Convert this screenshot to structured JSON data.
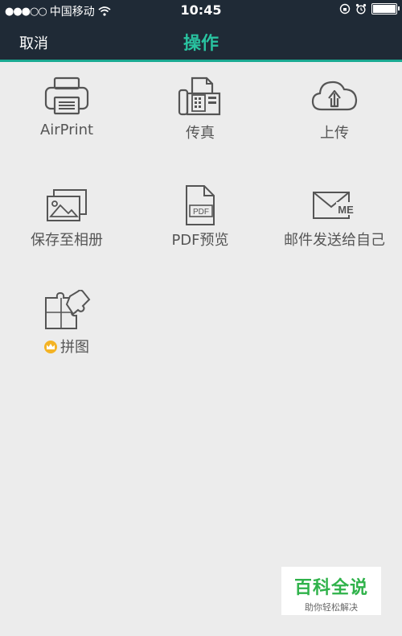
{
  "status": {
    "carrier": "中国移动",
    "time": "10:45"
  },
  "nav": {
    "cancel": "取消",
    "title": "操作"
  },
  "actions": [
    {
      "label": "AirPrint",
      "icon": "printer-icon"
    },
    {
      "label": "传真",
      "icon": "fax-icon"
    },
    {
      "label": "上传",
      "icon": "cloud-upload-icon"
    },
    {
      "label": "保存至相册",
      "icon": "photo-album-icon"
    },
    {
      "label": "PDF预览",
      "icon": "pdf-file-icon"
    },
    {
      "label": "邮件发送给自己",
      "icon": "mail-to-me-icon"
    },
    {
      "label": "拼图",
      "icon": "puzzle-icon",
      "premium": true
    }
  ],
  "icon_text": {
    "pdf": "PDF",
    "mail_me": "ME"
  },
  "watermark": {
    "title": "百科全说",
    "subtitle": "助你轻松解决"
  },
  "colors": {
    "bar": "#1f2a36",
    "title": "#29c3a0",
    "accent": "#1aaa92",
    "crown": "#f4b324",
    "watermark": "#2fb24a"
  }
}
